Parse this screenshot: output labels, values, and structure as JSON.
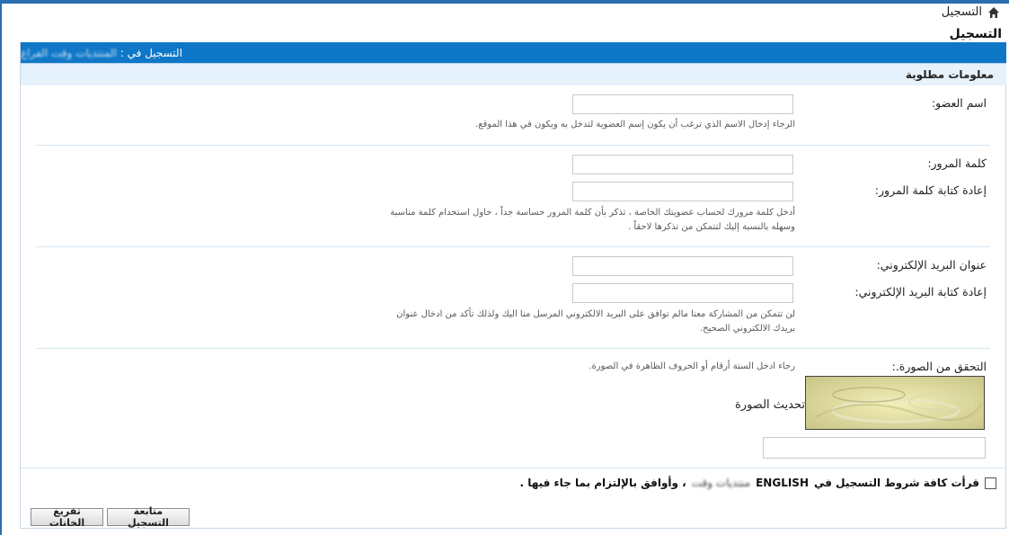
{
  "breadcrumb": {
    "label": "التسجيل"
  },
  "page": {
    "title": "التسجيل"
  },
  "form": {
    "header_prefix": "التسجيل في :",
    "header_site": "المنتديات وقت الفراغ",
    "section_title": "معلومات مطلوبة",
    "username": {
      "label": "اسم العضو:",
      "value": "",
      "hint": "الرجاء إدخال الاسم الذي ترغب أن يكون إسم العضوية لتدخل به ويكون في هذا الموقع."
    },
    "password": {
      "label": "كلمة المرور:",
      "value": "",
      "confirm_label": "إعادة كتابة كلمة المرور:",
      "confirm_value": "",
      "hint_line1": "أدخل كلمة مرورك لحساب عضويتك الخاصة ، تذكر بأن كلمة المرور حساسة جداً ، حاول استخدام كلمة مناسبة",
      "hint_line2": "وسهله بالنسبة إليك لتتمكن من تذكرها لاحقاً ."
    },
    "email": {
      "label": "عنوان البريد الإلكتروني:",
      "value": "",
      "confirm_label": "إعادة كتابة البريد الإلكتروني:",
      "confirm_value": "",
      "hint_line1": "لن تتمكن من المشاركة معنا مالم توافق على البريد الالكتروني المرسل منا اليك ولذلك تأكد من ادخال عنوان",
      "hint_line2": "بريدك الالكتروني الصحيح."
    },
    "captcha": {
      "label": "التحقق من الصورة.:",
      "hint": "رجاء ادخل الستة أرقام أو الحروف الظاهرة في الصورة.",
      "refresh_label": "تحديث الصورة",
      "value": ""
    },
    "terms": {
      "text_part1": "قرأت كافة شروط التسجيل في",
      "text_latin": "ENGLISH",
      "text_blurred": "منتديات وقت",
      "text_part2": "، وأوافق بالإلتزام بما جاء فيها .",
      "checked": false
    },
    "buttons": {
      "submit": "متابعة التسجيل",
      "reset": "تفريغ الخانات"
    }
  },
  "colors": {
    "header_blue": "#0e77c7",
    "subheader": "#e5f1fb",
    "frame": "#2a6fb0"
  },
  "icons": {
    "breadcrumb": "home-icon"
  }
}
